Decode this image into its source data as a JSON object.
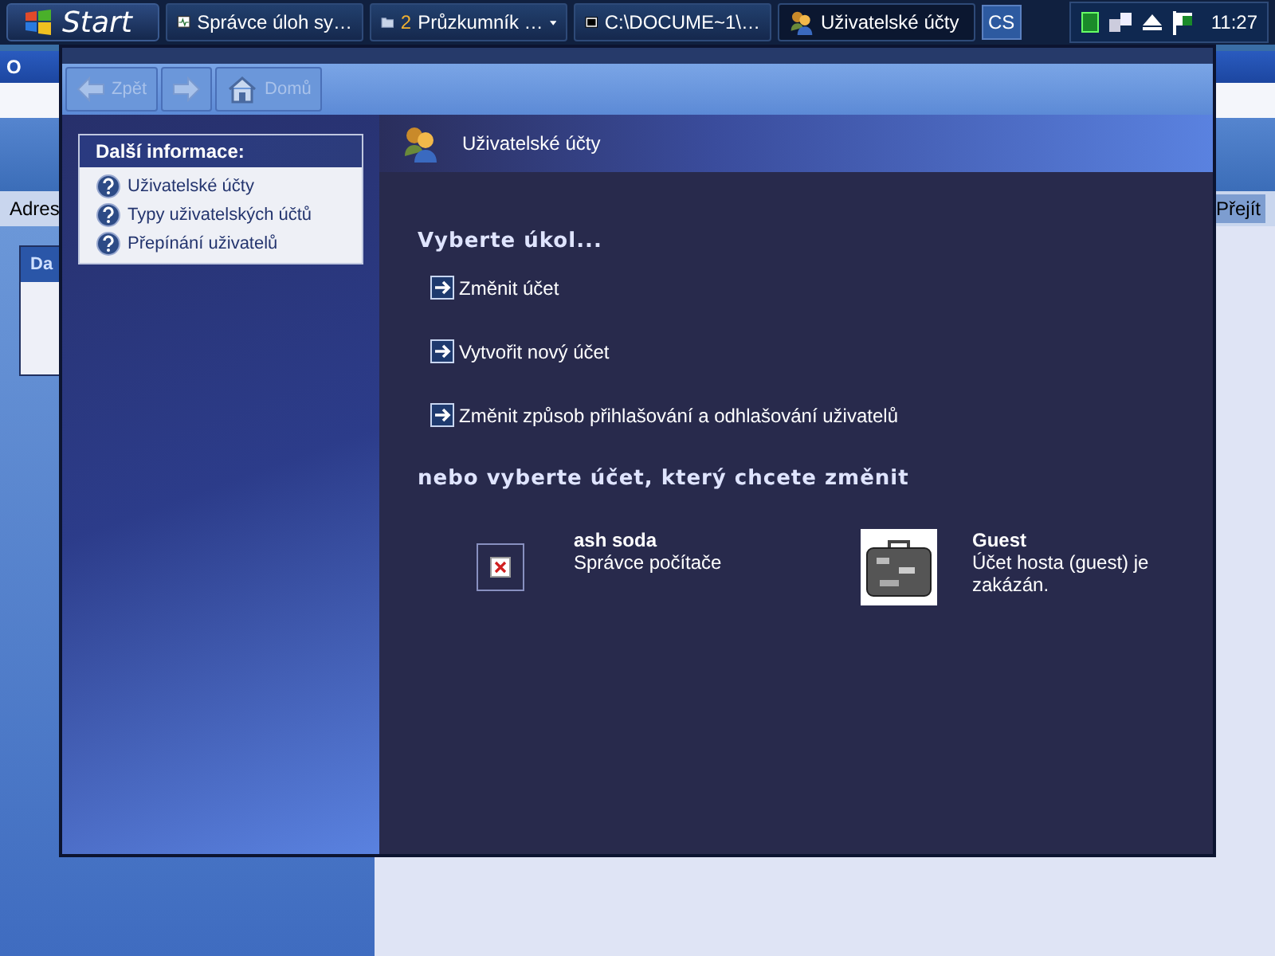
{
  "taskbar": {
    "start": "Start",
    "tasks": [
      {
        "label": "Správce úloh sy…",
        "menu": false,
        "selected": false
      },
      {
        "count": "2",
        "label": "Průzkumník …",
        "menu": true,
        "selected": false
      },
      {
        "label": "C:\\DOCUME~1\\…",
        "menu": false,
        "selected": false
      },
      {
        "label": "Uživatelské účty",
        "menu": false,
        "selected": true
      }
    ],
    "language": "CS",
    "clock": "11:27"
  },
  "back_window": {
    "title": "O",
    "address_label": "Adres",
    "go_button": "Přejít",
    "panel_title": "Da"
  },
  "window": {
    "toolbar": [
      {
        "kind": "back",
        "label": "Zpět",
        "disabled": true
      },
      {
        "kind": "forward",
        "disabled": true
      },
      {
        "kind": "home",
        "label": "Domů",
        "disabled": true
      }
    ],
    "sidebar": {
      "title": "Další informace:",
      "items": [
        "Uživatelské účty",
        "Typy uživatelských účtů",
        "Přepínání uživatelů"
      ]
    },
    "header": "Uživatelské účty",
    "task_heading": "Vyberte úkol...",
    "tasks": [
      "Změnit účet",
      "Vytvořit nový účet",
      "Změnit způsob přihlašování a odhlašování uživatelů"
    ],
    "accounts_heading": "nebo vyberte účet, který chcete změnit",
    "accounts": [
      {
        "kind": "missing",
        "name": "ash soda",
        "description": "Správce počítače"
      },
      {
        "kind": "suitcase",
        "name": "Guest",
        "description": "Účet hosta (guest) je zakázán."
      }
    ]
  }
}
